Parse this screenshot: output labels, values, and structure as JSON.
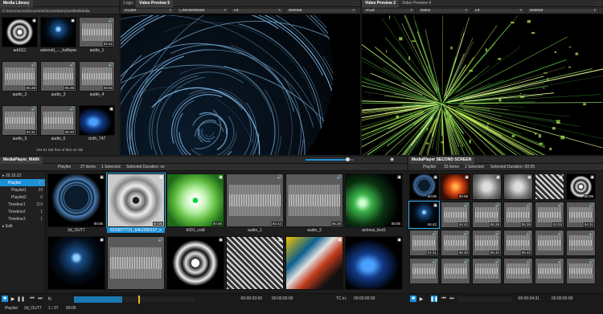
{
  "media_library": {
    "tab": "Media Library",
    "path": "C:\\Users\\secto\\Documents\\Screenberry\\untitled\\Media",
    "items": [
      {
        "label": "add111",
        "kind": "kaleido",
        "dur": ""
      },
      {
        "label": "asteroid_..._halfspeed",
        "kind": "particles",
        "dur": ""
      },
      {
        "label": "audio_1",
        "kind": "audio",
        "dur": "04:42"
      },
      {
        "label": "audio_2",
        "kind": "audio",
        "dur": "05:28"
      },
      {
        "label": "audio_3",
        "kind": "audio",
        "dur": "05:28"
      },
      {
        "label": "audio_4",
        "kind": "audio",
        "dur": "03:03"
      },
      {
        "label": "audio_5",
        "kind": "audio",
        "dur": "04:31"
      },
      {
        "label": "audio_6",
        "kind": "audio",
        "dur": "06:40"
      },
      {
        "label": "cloth_747",
        "kind": "cloth",
        "dur": ""
      }
    ],
    "disk_info": "194.51 GB free of 952.42 GB"
  },
  "preview1": {
    "tabs": [
      "Logo",
      "Video Preview 5"
    ],
    "active_tab": "Video Preview 5",
    "controls": [
      "RGBA",
      "Checkerboard",
      "Fit",
      "Bilinear"
    ]
  },
  "preview2": {
    "tabs": [
      "Video Preview 2",
      "Video Preview 4"
    ],
    "active_tab": "Video Preview 2",
    "controls": [
      "RGB",
      "Black",
      "Fit",
      "Bilinear"
    ]
  },
  "player_main": {
    "tab": "MediaPlayer_MAIN",
    "tree": [
      {
        "label": "20.10.22",
        "count": ""
      },
      {
        "label": "Playlist",
        "count": "27"
      },
      {
        "label": "Playlist1",
        "count": "29"
      },
      {
        "label": "Playlist2",
        "count": "0"
      },
      {
        "label": "Timeline1",
        "count": "119"
      },
      {
        "label": "Timeline2",
        "count": "1"
      },
      {
        "label": "Timeline3",
        "count": "1"
      },
      {
        "label": "Edit",
        "count": ""
      }
    ],
    "toolbar": {
      "playlist": "Playlist",
      "items": "27 items",
      "selected": "1 Selected",
      "duration": "Selected Duration: xx"
    },
    "row1": [
      {
        "label": "2d_OUT7",
        "kind": "spiral",
        "dur": "00:05"
      },
      {
        "label": "8253877721_64b1590157_o",
        "kind": "mandala",
        "dur": "00:05"
      },
      {
        "label": "h001_cold",
        "kind": "green",
        "dur": "00:05"
      },
      {
        "label": "audio_1",
        "kind": "audio",
        "dur": "04:42"
      },
      {
        "label": "audio_2",
        "kind": "audio",
        "dur": "05:28"
      },
      {
        "label": "actress_test1",
        "kind": "lines",
        "dur": "00:05"
      }
    ],
    "row2": [
      {
        "label": "",
        "kind": "particles",
        "dur": ""
      },
      {
        "label": "",
        "kind": "audio",
        "dur": ""
      },
      {
        "label": "",
        "kind": "kaleido",
        "dur": ""
      },
      {
        "label": "",
        "kind": "grid",
        "dur": ""
      },
      {
        "label": "",
        "kind": "colorful",
        "dur": ""
      },
      {
        "label": "",
        "kind": "cloth",
        "dur": ""
      }
    ],
    "status": {
      "playlist": "Playlist",
      "clip": "2d_OUT7",
      "index": "1 / 27",
      "time": "00:05"
    },
    "timeline": {
      "time_left": "-00:00:03:50",
      "time_right": "00:00:00:00",
      "tc": "TC in:",
      "tc_value": "00:00:00:00"
    }
  },
  "player_second": {
    "tab": "MediaPlayer SECOND SCREEN",
    "toolbar": {
      "playlist": "Playlist",
      "items": "33 items",
      "selected": "1 Selected",
      "duration": "Selected Duration: 00:05"
    },
    "durs": [
      "00:05",
      "00:05",
      "",
      "",
      "",
      "00:05",
      "04:42",
      "04:42",
      "05:28",
      "05:28",
      "03:03",
      "04:31",
      "04:31",
      "06:40",
      "06:40",
      "06:40"
    ],
    "timeline": {
      "time_left": "-00:00:04:31",
      "time_right": "00:00:00:00"
    }
  },
  "colors": {
    "accent": "#1c8fd6",
    "panel": "#2b2b2b",
    "bg": "#1b1b1b"
  }
}
